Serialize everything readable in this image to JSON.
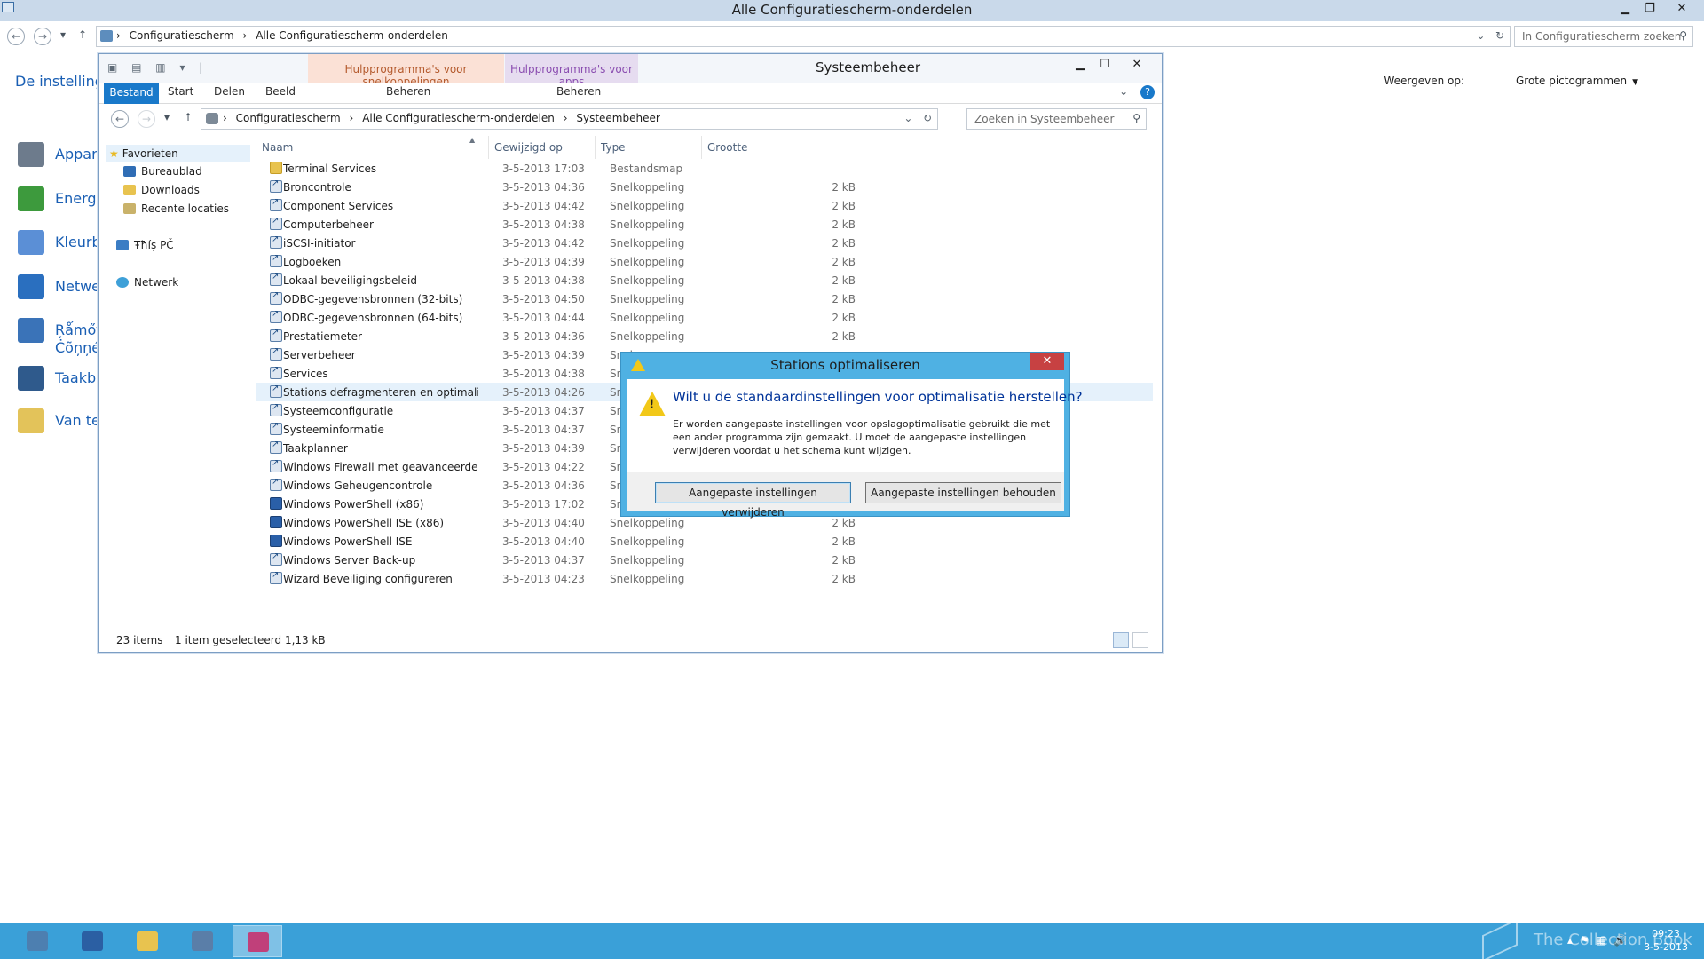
{
  "cp_window": {
    "title": "Alle Configuratiescherm-onderdelen",
    "address_crumbs": [
      "Configuratiescherm",
      "Alle Configuratiescherm-onderdelen"
    ],
    "search_placeholder": "In Configuratiescherm zoeken",
    "left_heading": "De instellinge",
    "view_label": "Weergeven op:",
    "view_value": "Grote pictogrammen",
    "items": [
      {
        "label": "Appara",
        "icon": "devices-icon",
        "color": "#6d7b8c"
      },
      {
        "label": "Energie",
        "icon": "power-icon",
        "color": "#3d9a3d"
      },
      {
        "label": "Kleurbe",
        "icon": "color-icon",
        "color": "#5b8fd6"
      },
      {
        "label": "Netwer",
        "icon": "network-icon",
        "color": "#2a6fbf"
      },
      {
        "label": "Ŗǻmőţę\nĊõņņé",
        "icon": "remote-icon",
        "color": "#3a73b8"
      },
      {
        "label": "Taakba",
        "icon": "taskbar-icon",
        "color": "#2f5a8c"
      },
      {
        "label": "Van tek",
        "icon": "speech-icon",
        "color": "#e3c35a"
      }
    ]
  },
  "explorer": {
    "title": "Systeembeheer",
    "context_tabs": [
      {
        "group": "Hulpprogramma's voor snelkoppelingen",
        "tab": "Beheren"
      },
      {
        "group": "Hulpprogramma's voor apps",
        "tab": "Beheren"
      }
    ],
    "ribbon_tabs": [
      "Bestand",
      "Start",
      "Delen",
      "Beeld"
    ],
    "address_crumbs": [
      "Configuratiescherm",
      "Alle Configuratiescherm-onderdelen",
      "Systeembeheer"
    ],
    "search_placeholder": "Zoeken in Systeembeheer",
    "nav": {
      "favorites": "Favorieten",
      "favorites_items": [
        "Bureaublad",
        "Downloads",
        "Recente locaties"
      ],
      "this_pc": "Ŧħíș PČ",
      "network": "Netwerk"
    },
    "columns": {
      "name": "Naam",
      "modified": "Gewijzigd op",
      "type": "Type",
      "size": "Grootte"
    },
    "rows": [
      {
        "name": "Terminal Services",
        "date": "3-5-2013 17:03",
        "type": "Bestandsmap",
        "size": "",
        "icon": "folder"
      },
      {
        "name": "Broncontrole",
        "date": "3-5-2013 04:36",
        "type": "Snelkoppeling",
        "size": "2 kB",
        "icon": "shortcut"
      },
      {
        "name": "Component Services",
        "date": "3-5-2013 04:42",
        "type": "Snelkoppeling",
        "size": "2 kB",
        "icon": "shortcut"
      },
      {
        "name": "Computerbeheer",
        "date": "3-5-2013 04:38",
        "type": "Snelkoppeling",
        "size": "2 kB",
        "icon": "shortcut"
      },
      {
        "name": "iSCSI-initiator",
        "date": "3-5-2013 04:42",
        "type": "Snelkoppeling",
        "size": "2 kB",
        "icon": "shortcut"
      },
      {
        "name": "Logboeken",
        "date": "3-5-2013 04:39",
        "type": "Snelkoppeling",
        "size": "2 kB",
        "icon": "shortcut"
      },
      {
        "name": "Lokaal beveiligingsbeleid",
        "date": "3-5-2013 04:38",
        "type": "Snelkoppeling",
        "size": "2 kB",
        "icon": "shortcut"
      },
      {
        "name": "ODBC-gegevensbronnen (32-bits)",
        "date": "3-5-2013 04:50",
        "type": "Snelkoppeling",
        "size": "2 kB",
        "icon": "shortcut"
      },
      {
        "name": "ODBC-gegevensbronnen (64-bits)",
        "date": "3-5-2013 04:44",
        "type": "Snelkoppeling",
        "size": "2 kB",
        "icon": "shortcut"
      },
      {
        "name": "Prestatiemeter",
        "date": "3-5-2013 04:36",
        "type": "Snelkoppeling",
        "size": "2 kB",
        "icon": "shortcut"
      },
      {
        "name": "Serverbeheer",
        "date": "3-5-2013 04:39",
        "type": "Snel",
        "size": "",
        "icon": "shortcut"
      },
      {
        "name": "Services",
        "date": "3-5-2013 04:38",
        "type": "Snel",
        "size": "",
        "icon": "shortcut"
      },
      {
        "name": "Stations defragmenteren en optimaliseren",
        "date": "3-5-2013 04:26",
        "type": "Snel",
        "size": "",
        "icon": "shortcut"
      },
      {
        "name": "Systeemconfiguratie",
        "date": "3-5-2013 04:37",
        "type": "Snel",
        "size": "",
        "icon": "shortcut"
      },
      {
        "name": "Systeeminformatie",
        "date": "3-5-2013 04:37",
        "type": "Snel",
        "size": "",
        "icon": "shortcut"
      },
      {
        "name": "Taakplanner",
        "date": "3-5-2013 04:39",
        "type": "Snel",
        "size": "",
        "icon": "shortcut"
      },
      {
        "name": "Windows Firewall met geavanceerde bev...",
        "date": "3-5-2013 04:22",
        "type": "Snel",
        "size": "",
        "icon": "shortcut"
      },
      {
        "name": "Windows Geheugencontrole",
        "date": "3-5-2013 04:36",
        "type": "Snel",
        "size": "",
        "icon": "shortcut"
      },
      {
        "name": "Windows PowerShell (x86)",
        "date": "3-5-2013 17:02",
        "type": "Snel",
        "size": "",
        "icon": "ps"
      },
      {
        "name": "Windows PowerShell ISE (x86)",
        "date": "3-5-2013 04:40",
        "type": "Snelkoppeling",
        "size": "2 kB",
        "icon": "ps"
      },
      {
        "name": "Windows PowerShell ISE",
        "date": "3-5-2013 04:40",
        "type": "Snelkoppeling",
        "size": "2 kB",
        "icon": "ps"
      },
      {
        "name": "Windows Server Back-up",
        "date": "3-5-2013 04:37",
        "type": "Snelkoppeling",
        "size": "2 kB",
        "icon": "shortcut"
      },
      {
        "name": "Wizard Beveiliging configureren",
        "date": "3-5-2013 04:23",
        "type": "Snelkoppeling",
        "size": "2 kB",
        "icon": "shortcut"
      }
    ],
    "selected_row": "Stations defragmenteren en optimaliseren",
    "status_count": "23 items",
    "status_selection": "1 item geselecteerd  1,13 kB"
  },
  "dialog": {
    "title": "Stations optimaliseren",
    "heading": "Wilt u de standaardinstellingen voor optimalisatie herstellen?",
    "text": "Er worden aangepaste instellingen voor opslagoptimalisatie gebruikt die met een ander programma zijn gemaakt. U moet de aangepaste instellingen verwijderen voordat u het schema kunt wijzigen.",
    "btn_remove": "Aangepaste instellingen verwijderen",
    "btn_keep": "Aangepaste instellingen behouden"
  },
  "taskbar": {
    "apps": [
      {
        "name": "server-manager-icon",
        "color": "#4d7fb0"
      },
      {
        "name": "powershell-icon",
        "color": "#2b5fa3"
      },
      {
        "name": "file-explorer-icon",
        "color": "#e8c34f"
      },
      {
        "name": "control-panel-icon",
        "color": "#5a7ea8"
      },
      {
        "name": "defrag-icon",
        "color": "#c0407a"
      }
    ],
    "watermark": "The Collection Book",
    "time": "09:23",
    "date": "3-5-2013"
  }
}
